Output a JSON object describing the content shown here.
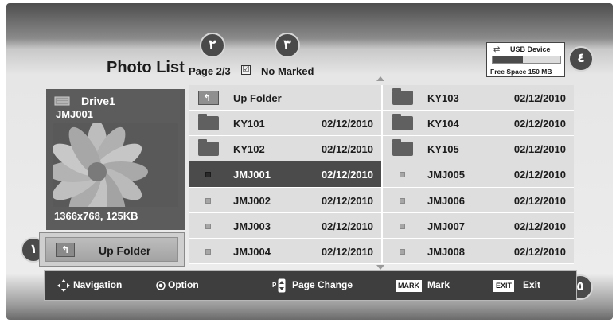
{
  "header": {
    "title": "Photo List",
    "page_indicator": "Page 2/3",
    "marked_status": "No Marked",
    "check_glyph": "☑"
  },
  "usb": {
    "device_label": "USB Device",
    "free_space": "Free Space 150 MB",
    "used_fraction": 0.45,
    "icon": "usb-icon"
  },
  "callouts": [
    "١",
    "٢",
    "٣",
    "٤",
    "٥"
  ],
  "preview": {
    "drive_label": "Drive1",
    "file_name": "JMJ001",
    "resolution": "1366x768, 125KB"
  },
  "up_folder_button": {
    "label": "Up Folder"
  },
  "file_list": {
    "left": [
      {
        "icon": "up-folder-icon",
        "name": "Up Folder",
        "date": ""
      },
      {
        "icon": "folder-icon",
        "name": "KY101",
        "date": "02/12/2010"
      },
      {
        "icon": "folder-icon",
        "name": "KY102",
        "date": "02/12/2010"
      },
      {
        "icon": "photo-file-icon",
        "name": "JMJ001",
        "date": "02/12/2010",
        "selected": true
      },
      {
        "icon": "photo-file-icon",
        "name": "JMJ002",
        "date": "02/12/2010"
      },
      {
        "icon": "photo-file-icon",
        "name": "JMJ003",
        "date": "02/12/2010"
      },
      {
        "icon": "photo-file-icon",
        "name": "JMJ004",
        "date": "02/12/2010"
      }
    ],
    "right": [
      {
        "icon": "folder-icon",
        "name": "KY103",
        "date": "02/12/2010"
      },
      {
        "icon": "folder-icon",
        "name": "KY104",
        "date": "02/12/2010"
      },
      {
        "icon": "folder-icon",
        "name": "KY105",
        "date": "02/12/2010"
      },
      {
        "icon": "photo-file-icon",
        "name": "JMJ005",
        "date": "02/12/2010"
      },
      {
        "icon": "photo-file-icon",
        "name": "JMJ006",
        "date": "02/12/2010"
      },
      {
        "icon": "photo-file-icon",
        "name": "JMJ007",
        "date": "02/12/2010"
      },
      {
        "icon": "photo-file-icon",
        "name": "JMJ008",
        "date": "02/12/2010"
      }
    ]
  },
  "navbar": {
    "navigation": "Navigation",
    "option": "Option",
    "page_key": "P",
    "page_change": "Page Change",
    "mark_key": "MARK",
    "mark": "Mark",
    "exit_key": "EXIT",
    "exit": "Exit"
  },
  "colors": {
    "selected_row": "#4b4b4b",
    "row": "#dedede",
    "navbar": "#3e3e3e",
    "callout": "#4a4a4a"
  }
}
